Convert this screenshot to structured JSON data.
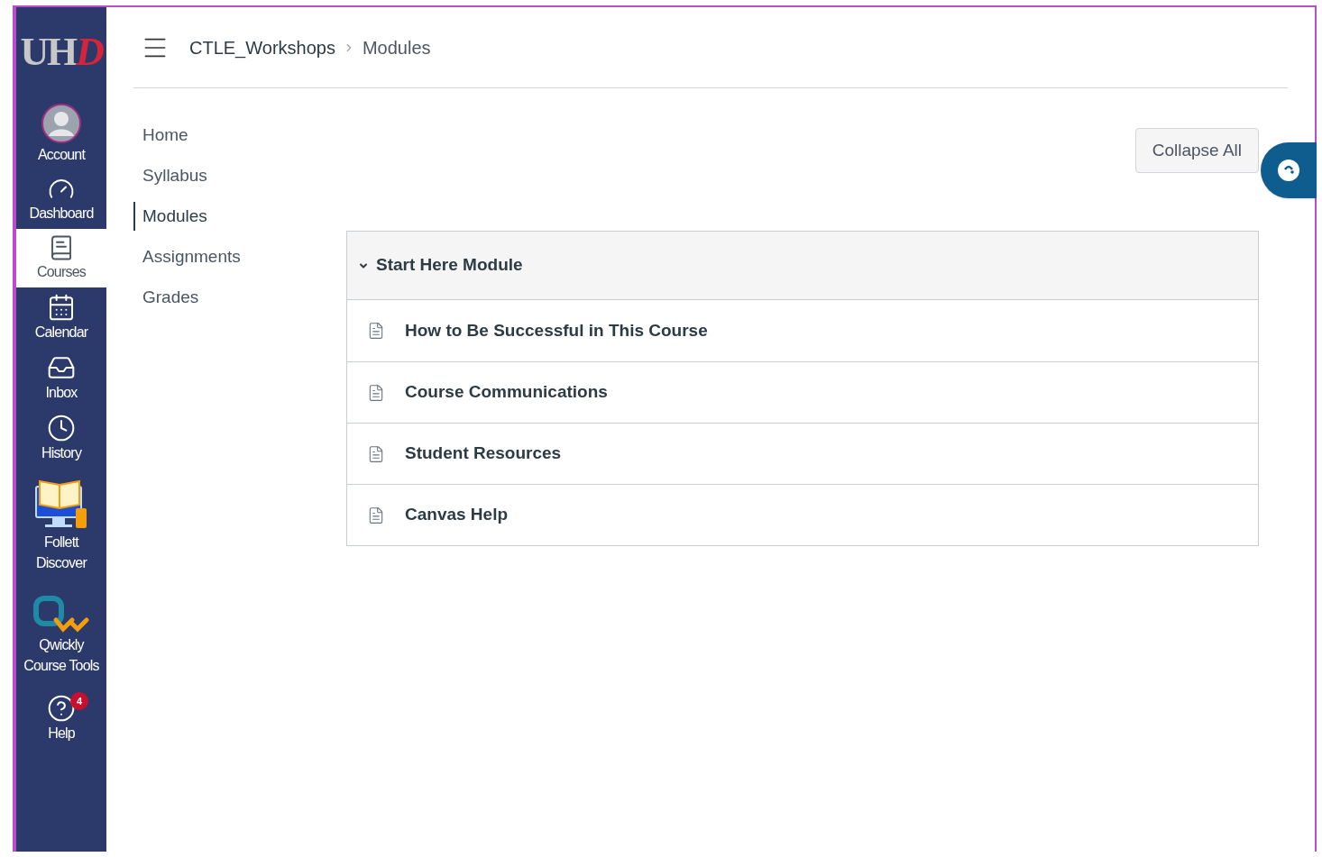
{
  "logo": {
    "text": "UH",
    "accent": "D"
  },
  "global_nav": [
    {
      "kind": "account",
      "label": "Account",
      "selected": false
    },
    {
      "kind": "dashboard",
      "label": "Dashboard",
      "selected": false
    },
    {
      "kind": "courses",
      "label": "Courses",
      "selected": true
    },
    {
      "kind": "calendar",
      "label": "Calendar",
      "selected": false
    },
    {
      "kind": "inbox",
      "label": "Inbox",
      "selected": false
    },
    {
      "kind": "history",
      "label": "History",
      "selected": false
    },
    {
      "kind": "follett",
      "label": "Follett Discover",
      "selected": false
    },
    {
      "kind": "qwickly",
      "label": "Qwickly Course Tools",
      "selected": false
    },
    {
      "kind": "help",
      "label": "Help",
      "selected": false,
      "badge": "4"
    }
  ],
  "breadcrumb": [
    "CTLE_Workshops",
    "Modules"
  ],
  "course_nav": [
    {
      "label": "Home",
      "selected": false
    },
    {
      "label": "Syllabus",
      "selected": false
    },
    {
      "label": "Modules",
      "selected": true
    },
    {
      "label": "Assignments",
      "selected": false
    },
    {
      "label": "Grades",
      "selected": false
    }
  ],
  "collapse_button": "Collapse All",
  "module": {
    "title": "Start Here Module",
    "expanded": true,
    "items": [
      "How to Be Successful in This Course",
      "Course Communications",
      "Student Resources",
      "Canvas Help"
    ]
  }
}
